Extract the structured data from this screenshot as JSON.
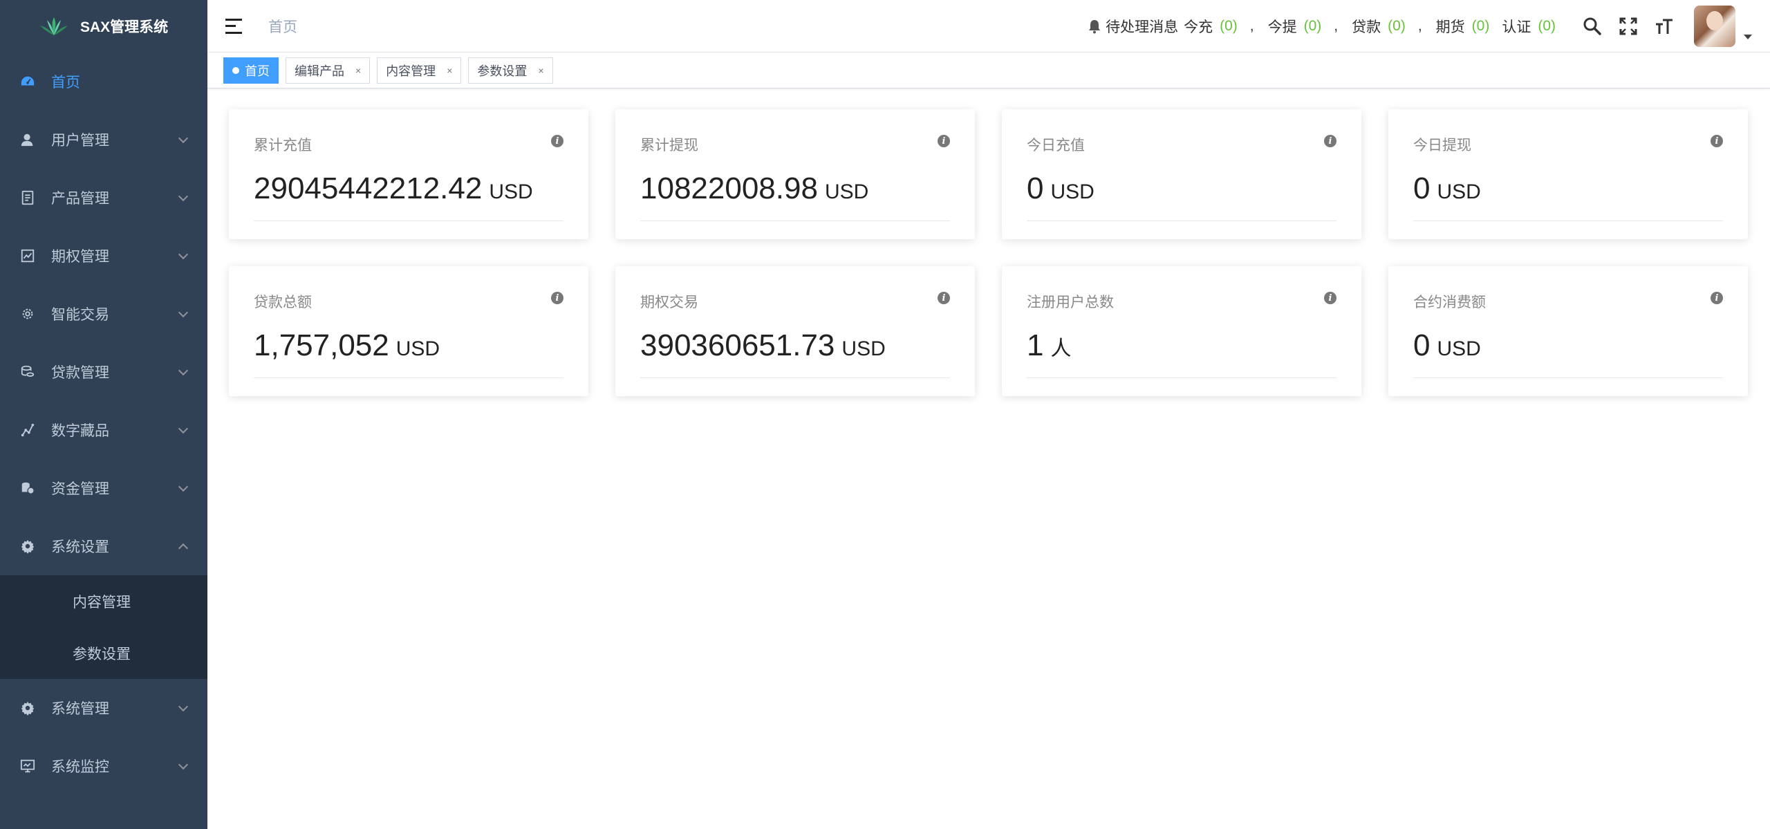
{
  "app": {
    "title": "SAX管理系统"
  },
  "sidebar": {
    "items": [
      {
        "label": "首页",
        "icon": "dashboard-icon",
        "active": true
      },
      {
        "label": "用户管理",
        "icon": "user-icon"
      },
      {
        "label": "产品管理",
        "icon": "document-icon"
      },
      {
        "label": "期权管理",
        "icon": "chart-icon"
      },
      {
        "label": "智能交易",
        "icon": "cog-icon"
      },
      {
        "label": "贷款管理",
        "icon": "coins-icon"
      },
      {
        "label": "数字藏品",
        "icon": "graph-icon"
      },
      {
        "label": "资金管理",
        "icon": "money-icon"
      },
      {
        "label": "系统设置",
        "icon": "gear-icon",
        "expanded": true
      },
      {
        "label": "系统管理",
        "icon": "gear-icon"
      },
      {
        "label": "系统监控",
        "icon": "monitor-icon"
      }
    ],
    "submenu": [
      "内容管理",
      "参数设置"
    ]
  },
  "header": {
    "breadcrumb": "首页",
    "notice": {
      "prefix": "待处理消息",
      "items": [
        {
          "label": "今充",
          "count": "(0)",
          "sep": ","
        },
        {
          "label": "今提",
          "count": "(0)",
          "sep": ","
        },
        {
          "label": "贷款",
          "count": "(0)",
          "sep": ","
        },
        {
          "label": "期货",
          "count": "(0)",
          "sep": ""
        },
        {
          "label": "认证",
          "count": "(0)",
          "sep": ""
        }
      ]
    }
  },
  "tags": [
    {
      "label": "首页",
      "active": true
    },
    {
      "label": "编辑产品",
      "close": "×"
    },
    {
      "label": "内容管理",
      "close": "×"
    },
    {
      "label": "参数设置",
      "close": "×"
    }
  ],
  "cards": [
    {
      "title": "累计充值",
      "value": "29045442212.42",
      "unit": "USD"
    },
    {
      "title": "累计提现",
      "value": "10822008.98",
      "unit": "USD"
    },
    {
      "title": "今日充值",
      "value": "0",
      "unit": "USD"
    },
    {
      "title": "今日提现",
      "value": "0",
      "unit": "USD"
    },
    {
      "title": "贷款总额",
      "value": "1,757,052",
      "unit": "USD"
    },
    {
      "title": "期权交易",
      "value": "390360651.73",
      "unit": "USD"
    },
    {
      "title": "注册用户总数",
      "value": "1",
      "unit": "人"
    },
    {
      "title": "合约消费额",
      "value": "0",
      "unit": "USD"
    }
  ],
  "info_glyph": "i",
  "colors": {
    "sidebar": "#304156",
    "submenu": "#1f2d3d",
    "accent": "#409eff",
    "count": "#67c23a"
  }
}
